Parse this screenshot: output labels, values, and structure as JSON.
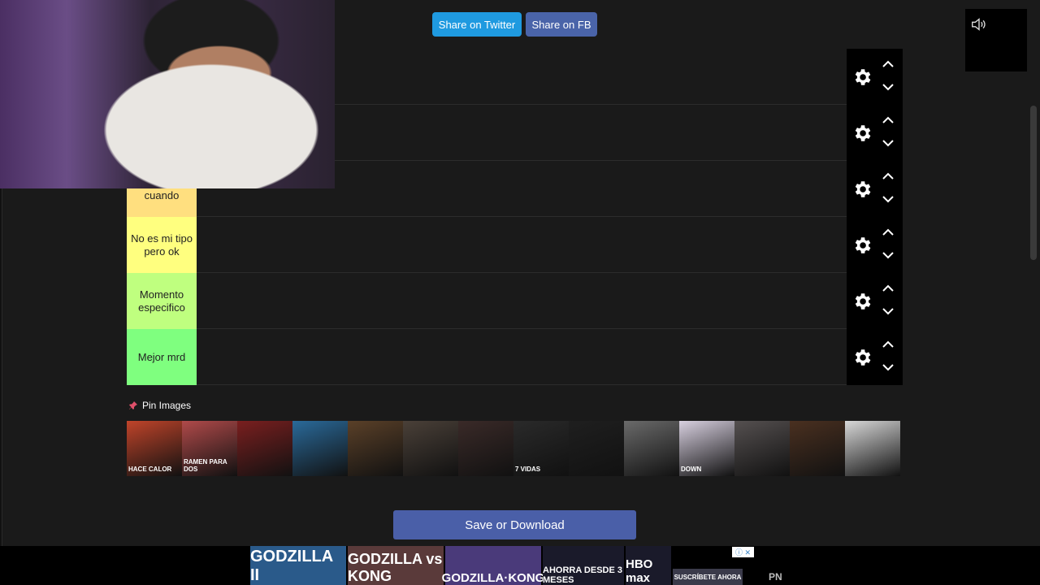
{
  "share": {
    "twitter": "Share on Twitter",
    "facebook": "Share on FB"
  },
  "tiers": [
    {
      "label": "",
      "color": "#ff7f7f"
    },
    {
      "label": "",
      "color": "#ffbf7f"
    },
    {
      "label": "de vez en cuando",
      "color": "#ffdf7f"
    },
    {
      "label": "No es mi tipo pero ok",
      "color": "#ffff7f"
    },
    {
      "label": "Momento especifico",
      "color": "#bfff7f"
    },
    {
      "label": "Mejor mrd",
      "color": "#7fff7f"
    }
  ],
  "pin": {
    "label": "Pin Images"
  },
  "thumbnails": [
    {
      "text": "HACE CALOR",
      "color": "#c0442a"
    },
    {
      "text": "RAMEN PARA DOS",
      "color": "#b04a4a"
    },
    {
      "text": "",
      "color": "#7a1f1f"
    },
    {
      "text": "",
      "color": "#2a6a9a"
    },
    {
      "text": "",
      "color": "#5a4028"
    },
    {
      "text": "",
      "color": "#4a4038"
    },
    {
      "text": "",
      "color": "#3a2a28"
    },
    {
      "text": "7 VIDAS",
      "color": "#2a2a2a"
    },
    {
      "text": "",
      "color": "#1f1f1f"
    },
    {
      "text": "",
      "color": "#6a6a6a"
    },
    {
      "text": "DOWN",
      "color": "#d8d0e0"
    },
    {
      "text": "",
      "color": "#555050"
    },
    {
      "text": "",
      "color": "#4a3020"
    },
    {
      "text": "",
      "color": "#d8d8d8"
    }
  ],
  "save": {
    "label": "Save or Download"
  },
  "ad": {
    "tiles": [
      "GODZILLA II",
      "GODZILLA vs KONG",
      "GODZILLA·KONG",
      "AHORRA DESDE 3 MESES",
      "HBO max",
      "SUSCRÍBETE AHORA"
    ],
    "corner": "PN"
  }
}
